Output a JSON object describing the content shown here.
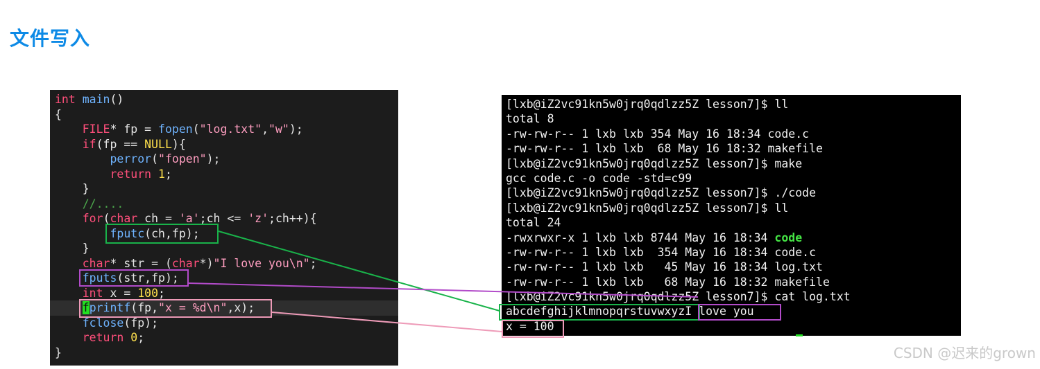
{
  "page": {
    "title": "文件写入"
  },
  "editor": {
    "lines": [
      [
        {
          "c": "kw",
          "t": "int"
        },
        {
          "t": " "
        },
        {
          "c": "fn",
          "t": "main"
        },
        {
          "t": "()"
        }
      ],
      [
        {
          "t": "{"
        }
      ],
      [
        {
          "t": "    "
        },
        {
          "c": "kw",
          "t": "FILE"
        },
        {
          "t": "* fp = "
        },
        {
          "c": "fn",
          "t": "fopen"
        },
        {
          "t": "("
        },
        {
          "c": "str",
          "t": "\"log.txt\""
        },
        {
          "t": ","
        },
        {
          "c": "str",
          "t": "\"w\""
        },
        {
          "t": ");"
        }
      ],
      [
        {
          "t": "    "
        },
        {
          "c": "kw",
          "t": "if"
        },
        {
          "t": "(fp == "
        },
        {
          "c": "nul",
          "t": "NULL"
        },
        {
          "t": "){"
        }
      ],
      [
        {
          "t": "        "
        },
        {
          "c": "fn",
          "t": "perror"
        },
        {
          "t": "("
        },
        {
          "c": "str",
          "t": "\"fopen\""
        },
        {
          "t": ");"
        }
      ],
      [
        {
          "t": "        "
        },
        {
          "c": "kw",
          "t": "return"
        },
        {
          "t": " "
        },
        {
          "c": "num",
          "t": "1"
        },
        {
          "t": ";"
        }
      ],
      [
        {
          "t": "    }"
        }
      ],
      [
        {
          "t": "    "
        },
        {
          "c": "cmt",
          "t": "//...."
        }
      ],
      [
        {
          "t": "    "
        },
        {
          "c": "kw",
          "t": "for"
        },
        {
          "t": "("
        },
        {
          "c": "kw",
          "t": "char"
        },
        {
          "t": " ch = "
        },
        {
          "c": "str",
          "t": "'a'"
        },
        {
          "t": ";ch <= "
        },
        {
          "c": "str",
          "t": "'z'"
        },
        {
          "t": ";ch++){"
        }
      ],
      [
        {
          "t": "        "
        },
        {
          "c": "fn",
          "t": "fputc"
        },
        {
          "t": "(ch,fp);"
        }
      ],
      [
        {
          "t": "    }"
        }
      ],
      [
        {
          "t": "    "
        },
        {
          "c": "kw",
          "t": "char"
        },
        {
          "t": "* str = ("
        },
        {
          "c": "kw",
          "t": "char"
        },
        {
          "t": "*)"
        },
        {
          "c": "str",
          "t": "\"I love you\\n\""
        },
        {
          "t": ";"
        }
      ],
      [
        {
          "t": "    "
        },
        {
          "c": "fn",
          "t": "fputs"
        },
        {
          "t": "(str,fp);"
        }
      ],
      [
        {
          "t": "    "
        },
        {
          "c": "kw",
          "t": "int"
        },
        {
          "t": " x = "
        },
        {
          "c": "num",
          "t": "100"
        },
        {
          "t": ";"
        }
      ],
      [
        {
          "t": "    "
        },
        {
          "c": "cur",
          "t": "f"
        },
        {
          "c": "fn",
          "t": "printf"
        },
        {
          "t": "(fp,"
        },
        {
          "c": "str",
          "t": "\"x = %d\\n\""
        },
        {
          "t": ",x);"
        }
      ],
      [
        {
          "t": "    "
        },
        {
          "c": "fn",
          "t": "fclose"
        },
        {
          "t": "(fp);"
        }
      ],
      [
        {
          "t": "    "
        },
        {
          "c": "kw",
          "t": "return"
        },
        {
          "t": " "
        },
        {
          "c": "num",
          "t": "0"
        },
        {
          "t": ";"
        }
      ],
      [
        {
          "t": "}"
        }
      ]
    ]
  },
  "terminal": {
    "lines": [
      [
        {
          "t": "[lxb@iZ2vc91kn5w0jrq0qdlzz5Z lesson7]$ ll"
        }
      ],
      [
        {
          "t": "total 8"
        }
      ],
      [
        {
          "t": "-rw-rw-r-- 1 lxb lxb 354 May 16 18:34 code.c"
        }
      ],
      [
        {
          "t": "-rw-rw-r-- 1 lxb lxb  68 May 16 18:32 makefile"
        }
      ],
      [
        {
          "t": "[lxb@iZ2vc91kn5w0jrq0qdlzz5Z lesson7]$ make"
        }
      ],
      [
        {
          "t": "gcc code.c -o code -std=c99"
        }
      ],
      [
        {
          "t": "[lxb@iZ2vc91kn5w0jrq0qdlzz5Z lesson7]$ ./code"
        }
      ],
      [
        {
          "t": "[lxb@iZ2vc91kn5w0jrq0qdlzz5Z lesson7]$ ll"
        }
      ],
      [
        {
          "t": "total 24"
        }
      ],
      [
        {
          "t": "-rwxrwxr-x 1 lxb lxb 8744 May 16 18:34 "
        },
        {
          "c": "exe",
          "t": "code"
        }
      ],
      [
        {
          "t": "-rw-rw-r-- 1 lxb lxb  354 May 16 18:34 code.c"
        }
      ],
      [
        {
          "t": "-rw-rw-r-- 1 lxb lxb   45 May 16 18:34 log.txt"
        }
      ],
      [
        {
          "t": "-rw-rw-r-- 1 lxb lxb   68 May 16 18:32 makefile"
        }
      ],
      [
        {
          "t": "[lxb@iZ2vc91kn5w0jrq0qdlzz5Z lesson7]$ cat log.txt"
        }
      ],
      [
        {
          "t": "abcdefghijklmnopqrstuvwxyzI love you"
        }
      ],
      [
        {
          "t": "x = 100"
        }
      ]
    ]
  },
  "colors": {
    "title": "#0d8ae6",
    "green_box": "#19b34a",
    "purple_box": "#b24bc9",
    "pink_box": "#ee9bb8"
  },
  "watermark": "CSDN @迟来的grown"
}
